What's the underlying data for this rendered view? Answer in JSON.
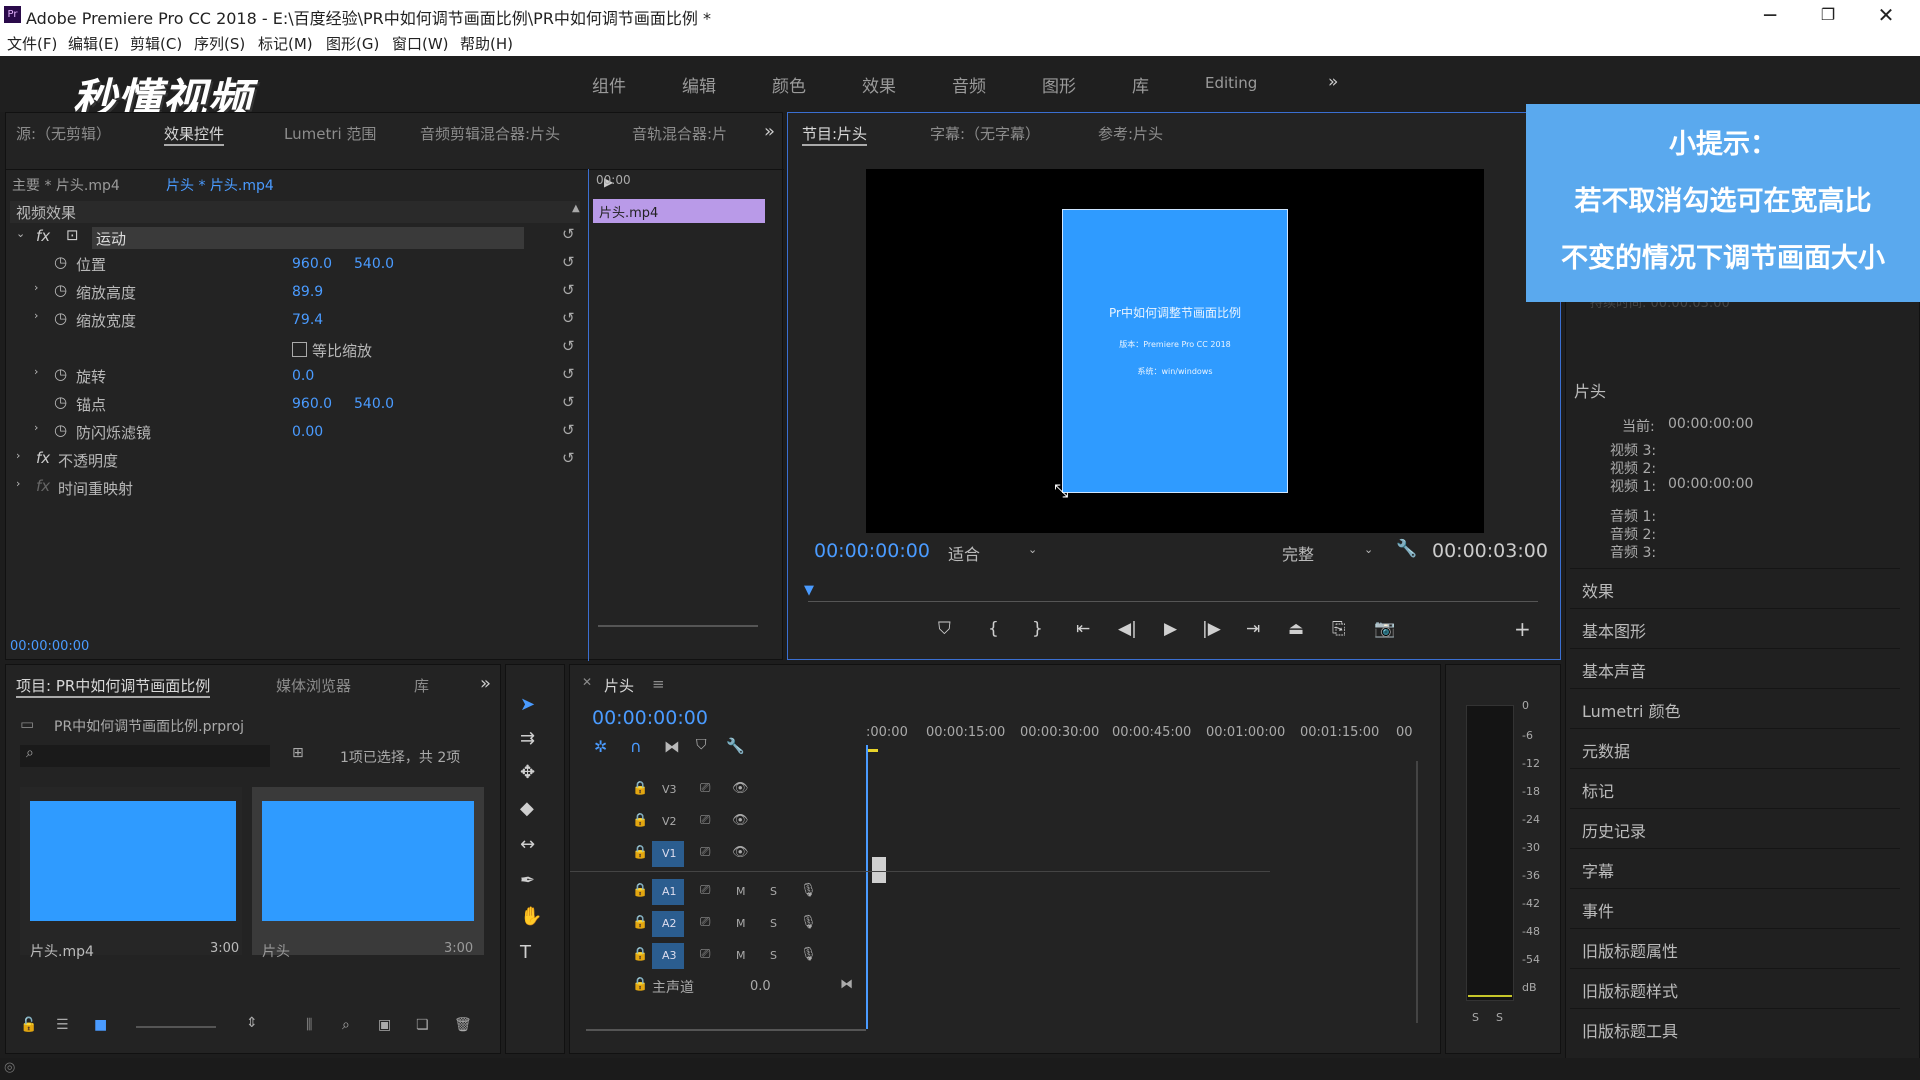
{
  "window": {
    "app_icon": "Pr",
    "title": "Adobe Premiere Pro CC 2018 - E:\\百度经验\\PR中如何调节画面比例\\PR中如何调节画面比例 *",
    "minimize": "─",
    "maximize": "❐",
    "close": "✕"
  },
  "menu": [
    "文件(F)",
    "编辑(E)",
    "剪辑(C)",
    "序列(S)",
    "标记(M)",
    "图形(G)",
    "窗口(W)",
    "帮助(H)"
  ],
  "logo": "秒懂视频",
  "workspaces": [
    "组件",
    "编辑",
    "颜色",
    "效果",
    "音频",
    "图形",
    "库",
    "Editing",
    "»"
  ],
  "source_tabs": [
    "源:（无剪辑）",
    "效果控件",
    "Lumetri 范围",
    "音频剪辑混合器:片头",
    "音轨混合器:片"
  ],
  "effect_controls": {
    "master": "主要 * 片头.mp4",
    "clip": "片头 * 片头.mp4",
    "timecode_head": "00:00",
    "clip_bar": "片头.mp4",
    "section": "视频效果",
    "motion": "运动",
    "position_label": "位置",
    "position_x": "960.0",
    "position_y": "540.0",
    "scale_h_label": "缩放高度",
    "scale_h": "89.9",
    "scale_w_label": "缩放宽度",
    "scale_w": "79.4",
    "uniform_label": "等比缩放",
    "rotation_label": "旋转",
    "rotation": "0.0",
    "anchor_label": "锚点",
    "anchor_x": "960.0",
    "anchor_y": "540.0",
    "flicker_label": "防闪烁滤镜",
    "flicker": "0.00",
    "opacity": "不透明度",
    "remap": "时间重映射",
    "time": "00:00:00:00"
  },
  "program": {
    "tabs": [
      "节目:片头",
      "字幕:（无字幕）",
      "参考:片头"
    ],
    "timecode": "00:00:00:00",
    "fit": "适合",
    "quality": "完整",
    "duration": "00:00:03:00",
    "slide_title": "Pr中如何调整节画面比例",
    "slide_line1": "版本：Premiere Pro CC 2018",
    "slide_line2": "系统：win/windows"
  },
  "tip": {
    "title": "小提示：",
    "line1": "若不取消勾选可在宽高比",
    "line2": "不变的情况下调节画面大小"
  },
  "info_panel": {
    "section": "片头",
    "current_label": "当前:",
    "current": "00:00:00:00",
    "v3": "视频 3:",
    "v2": "视频 2:",
    "v1": "视频 1:",
    "v1_val": "00:00:00:00",
    "a1": "音频 1:",
    "a2": "音频 2:",
    "a3": "音频 3:",
    "faded": "持续时间: 00:00:03:00"
  },
  "right_panels": [
    "效果",
    "基本图形",
    "基本声音",
    "Lumetri 颜色",
    "元数据",
    "标记",
    "历史记录",
    "字幕",
    "事件",
    "旧版标题属性",
    "旧版标题样式",
    "旧版标题工具"
  ],
  "project": {
    "tabs": [
      "项目: PR中如何调节画面比例",
      "媒体浏览器",
      "库"
    ],
    "file": "PR中如何调节画面比例.prproj",
    "selection": "1项已选择，共 2项",
    "items": [
      {
        "name": "片头.mp4",
        "duration": "3:00"
      },
      {
        "name": "片头",
        "duration": "3:00"
      }
    ]
  },
  "timeline": {
    "tab": "片头",
    "timecode": "00:00:00:00",
    "ruler": [
      ":00:00",
      "00:00:15:00",
      "00:00:30:00",
      "00:00:45:00",
      "00:01:00:00",
      "00:01:15:00",
      "00"
    ],
    "video_tracks": [
      "V3",
      "V2",
      "V1"
    ],
    "audio_tracks": [
      "A1",
      "A2",
      "A3"
    ],
    "master": "主声道",
    "master_val": "0.0"
  },
  "meter": {
    "scale": [
      "0",
      "-6",
      "-12",
      "-18",
      "-24",
      "-30",
      "-36",
      "-42",
      "-48",
      "-54",
      "dB"
    ],
    "solo_left": "S",
    "solo_right": "S"
  },
  "colors": {
    "accent": "#4a9bff",
    "clip": "#b99ae8",
    "slide": "#2f9bff",
    "tip": "#5aa9ee"
  }
}
